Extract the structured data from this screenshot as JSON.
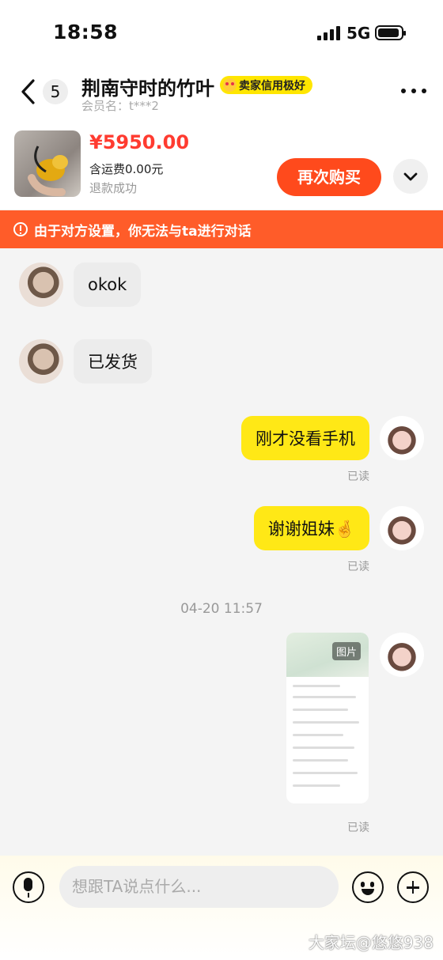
{
  "status": {
    "time": "18:58",
    "network": "5G"
  },
  "header": {
    "unread_count": "5",
    "seller_name": "荆南守时的竹叶",
    "credit_badge": "卖家信用极好",
    "member_label": "会员名：t***2"
  },
  "product": {
    "price": "¥5950.00",
    "shipping": "含运费0.00元",
    "status": "退款成功",
    "buy_again_label": "再次购买"
  },
  "notice": "由于对方设置，你无法与ta进行对话",
  "messages": [
    {
      "side": "left",
      "text": "okok"
    },
    {
      "side": "left",
      "text": "已发货"
    },
    {
      "side": "right",
      "text": "刚才没看手机",
      "read": "已读"
    },
    {
      "side": "right",
      "text": "谢谢姐妹🤞",
      "read": "已读"
    },
    {
      "type": "timestamp",
      "text": "04-20 11:57"
    },
    {
      "side": "right",
      "type": "image",
      "tag": "图片",
      "read": "已读"
    }
  ],
  "composer": {
    "placeholder": "想跟TA说点什么..."
  },
  "watermark": "大家坛@悠悠938",
  "colors": {
    "accent_orange": "#ff4a1c",
    "price_red": "#ff3b30",
    "bubble_yellow": "#ffe816",
    "notice_bg": "#ff5c29"
  }
}
